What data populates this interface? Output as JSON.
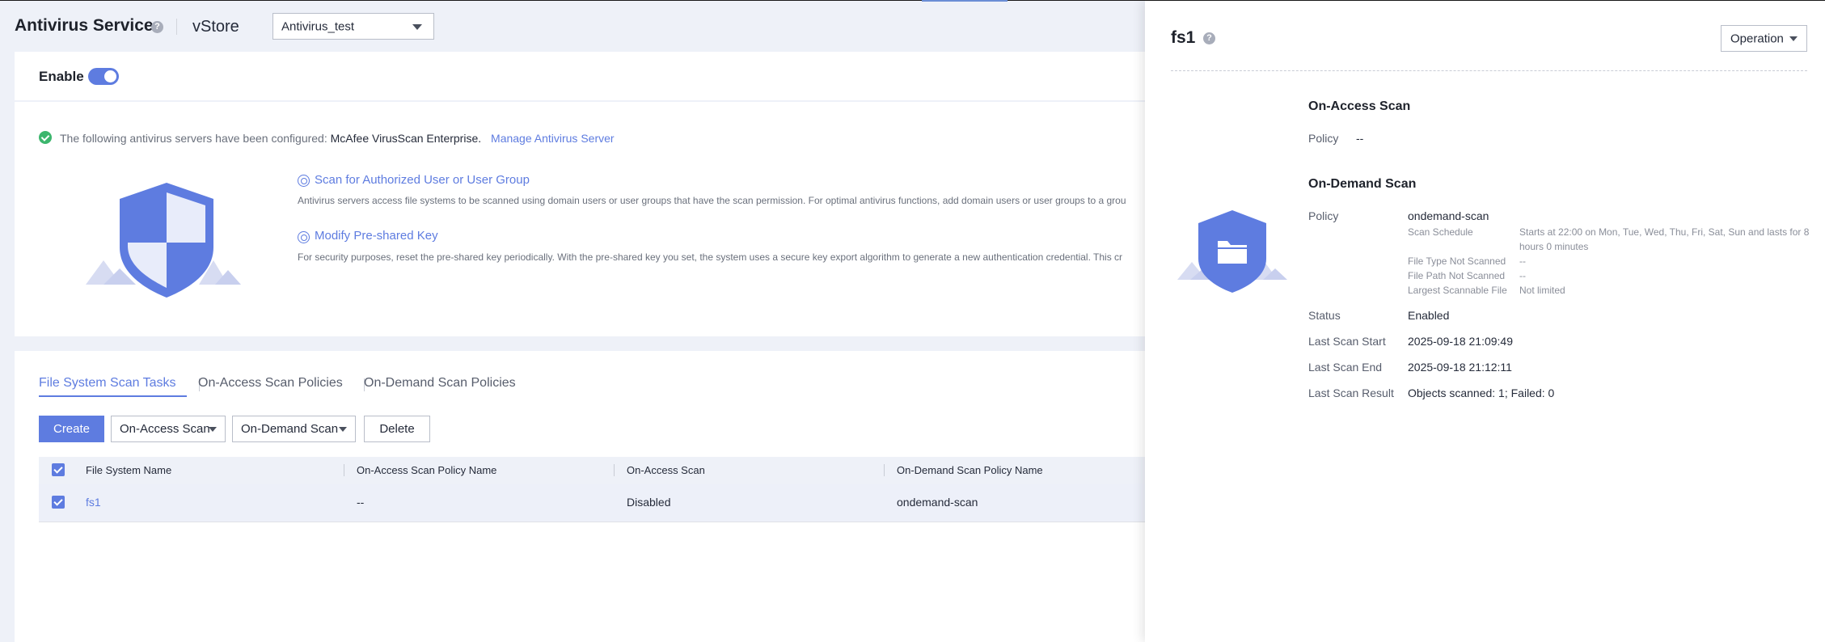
{
  "header": {
    "title": "Antivirus Service",
    "help_icon": "question-icon",
    "vstore_label": "vStore",
    "vstore_value": "Antivirus_test"
  },
  "enable": {
    "label": "Enable",
    "state": "on"
  },
  "info": {
    "servers_prefix": "The following antivirus servers have been configured:",
    "servers_name": "McAfee VirusScan Enterprise.",
    "manage_link": "Manage Antivirus Server",
    "features": [
      {
        "title": "Scan for Authorized User or User Group",
        "desc": "Antivirus servers access file systems to be scanned using domain users or user groups that have the scan permission. For optimal antivirus functions, add domain users or user groups to a grou"
      },
      {
        "title": "Modify Pre-shared Key",
        "desc": "For security purposes, reset the pre-shared key periodically. With the pre-shared key you set, the system uses a secure key export algorithm to generate a new authentication credential. This cr"
      }
    ]
  },
  "tabs": [
    "File System Scan Tasks",
    "On-Access Scan Policies",
    "On-Demand Scan Policies"
  ],
  "toolbar": {
    "create": "Create",
    "on_access": "On-Access Scan",
    "on_demand": "On-Demand Scan",
    "delete": "Delete"
  },
  "table": {
    "columns": [
      "File System Name",
      "On-Access Scan Policy Name",
      "On-Access Scan",
      "On-Demand Scan Policy Name"
    ],
    "rows": [
      {
        "name": "fs1",
        "on_access_policy": "--",
        "on_access_scan": "Disabled",
        "on_demand_policy": "ondemand-scan",
        "checked": true
      }
    ]
  },
  "drawer": {
    "title": "fs1",
    "operation": "Operation",
    "on_access": {
      "title": "On-Access Scan",
      "policy_key": "Policy",
      "policy_val": "--"
    },
    "on_demand": {
      "title": "On-Demand Scan",
      "policy_key": "Policy",
      "policy_val": "ondemand-scan",
      "schedule_key": "Scan Schedule",
      "schedule_val": "Starts at 22:00 on Mon, Tue, Wed, Thu, Fri, Sat, Sun and lasts for 8 hours 0 minutes",
      "filetype_key": "File Type Not Scanned",
      "filetype_val": "--",
      "filepath_key": "File Path Not Scanned",
      "filepath_val": "--",
      "largest_key": "Largest Scannable File",
      "largest_val": "Not limited",
      "status_key": "Status",
      "status_val": "Enabled",
      "start_key": "Last Scan Start",
      "start_val": "2025-09-18 21:09:49",
      "end_key": "Last Scan End",
      "end_val": "2025-09-18 21:12:11",
      "result_key": "Last Scan Result",
      "result_val": "Objects scanned: 1; Failed: 0"
    }
  },
  "colors": {
    "accent": "#5e7ce0",
    "success": "#3cb66d",
    "background": "#eef1f8"
  }
}
